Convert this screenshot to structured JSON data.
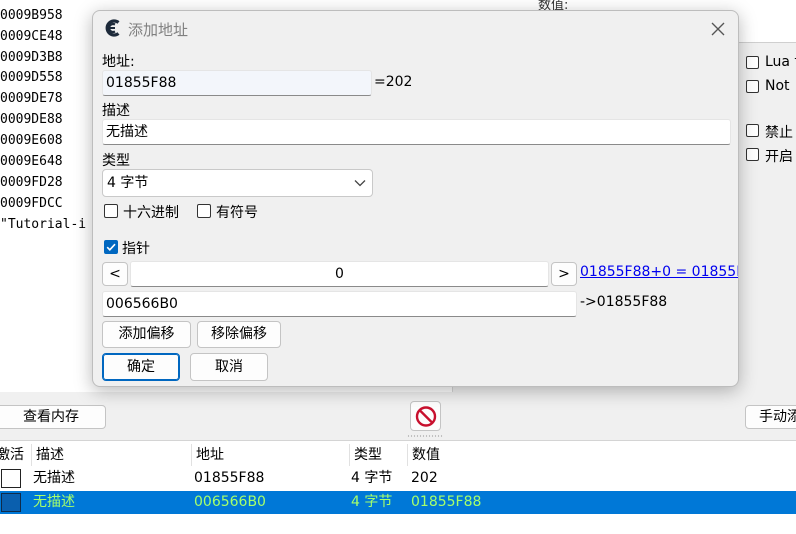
{
  "memory_list": {
    "addresses": [
      "0009B958",
      "0009CE48",
      "0009D3B8",
      "0009D558",
      "0009DE78",
      "0009DE88",
      "0009E608",
      "0009E648",
      "0009FD28",
      "0009FDCC"
    ],
    "last_line": "\"Tutorial-i"
  },
  "right_panel": {
    "value_header": "数值:",
    "options": [
      "Lua f",
      "Not",
      "禁止",
      "开启"
    ]
  },
  "mid_toolbar": {
    "view_memory": "查看内存",
    "add_manually": "手动添"
  },
  "cheat_table": {
    "headers": [
      "激活",
      "描述",
      "地址",
      "类型",
      "数值"
    ],
    "rows": [
      {
        "description": "无描述",
        "address": "01855F88",
        "type": "4 字节",
        "value": "202",
        "selected": false
      },
      {
        "description": "无描述",
        "address": "006566B0",
        "type": "4 字节",
        "value": "01855F88",
        "selected": true
      }
    ]
  },
  "dialog": {
    "title": "添加地址",
    "address_label": "地址:",
    "address_value": "01855F88",
    "address_result": "=202",
    "description_label": "描述",
    "description_value": "无描述",
    "type_label": "类型",
    "type_value": "4 字节",
    "hex_label": "十六进制",
    "signed_label": "有符号",
    "pointer_label": "指针",
    "pointer_checked": true,
    "offset_prev": "<",
    "offset_value": "0",
    "offset_next": ">",
    "offset_link": "01855F88+0 = 01855F",
    "base_address": "006566B0",
    "base_result": "->01855F88",
    "add_offset": "添加偏移",
    "remove_offset": "移除偏移",
    "ok": "确定",
    "cancel": "取消"
  },
  "colors": {
    "accent": "#0067c0",
    "selection": "#0078d7",
    "selected_text": "#a6ff6b",
    "link": "#0000ee"
  }
}
